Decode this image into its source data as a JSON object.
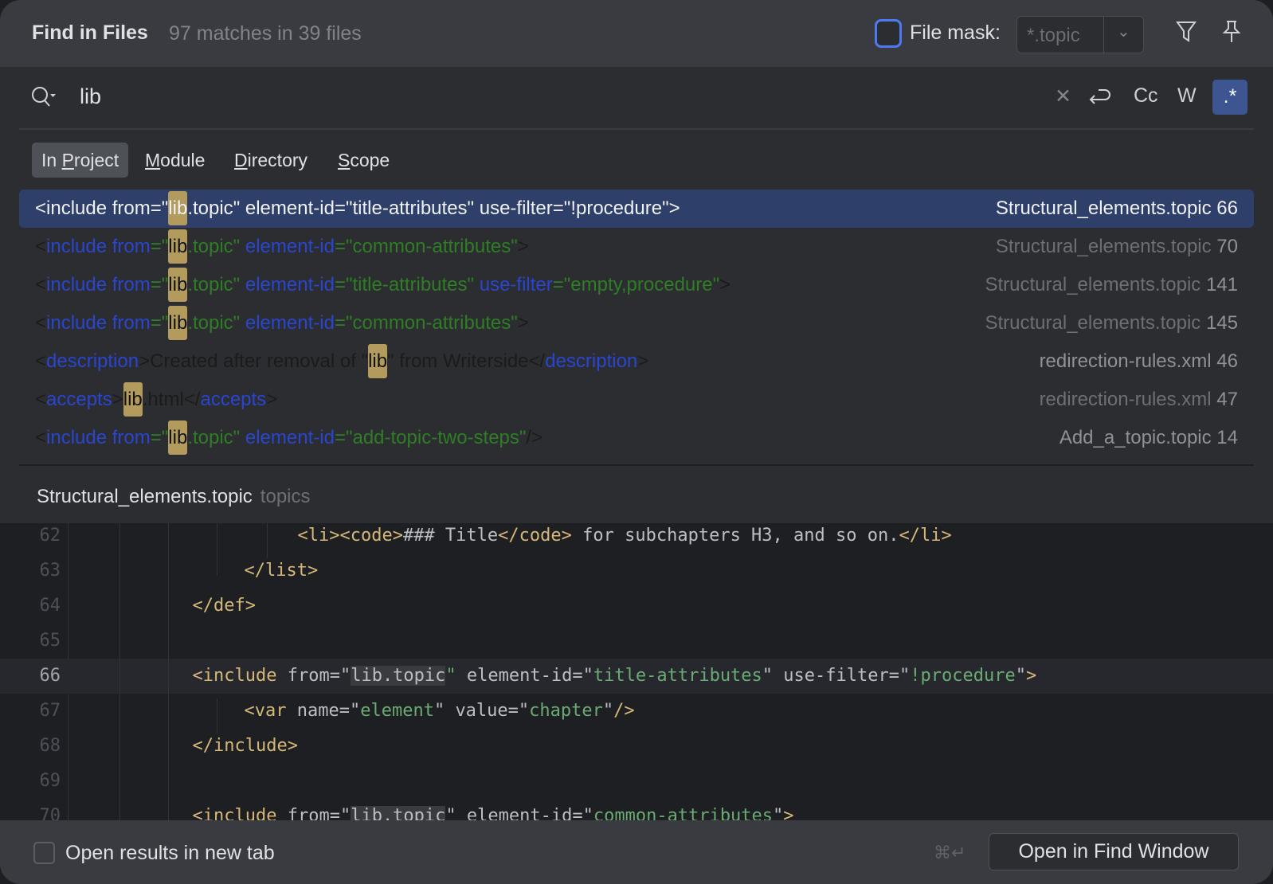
{
  "header": {
    "title": "Find in Files",
    "match_count": "97 matches in 39 files",
    "file_mask_label": "File mask:",
    "file_mask_value": "*.topic",
    "file_mask_checked": false
  },
  "search": {
    "query": "lib",
    "toggles": {
      "match_case": "Cc",
      "words": "W",
      "regex": ".*",
      "regex_active": true
    }
  },
  "scopes": [
    {
      "pre": "In ",
      "u": "P",
      "post": "roject",
      "active": true
    },
    {
      "pre": "",
      "u": "M",
      "post": "odule"
    },
    {
      "pre": "",
      "u": "D",
      "post": "irectory"
    },
    {
      "pre": "",
      "u": "S",
      "post": "cope"
    }
  ],
  "results": [
    {
      "selected": true,
      "segments": [
        [
          "c",
          "<"
        ],
        [
          "t",
          "include "
        ],
        [
          "t",
          "from"
        ],
        [
          "c",
          "=\""
        ],
        [
          "h",
          "lib"
        ],
        [
          "v",
          ".topic"
        ],
        [
          "c",
          "\" "
        ],
        [
          "t",
          "element-id"
        ],
        [
          "c",
          "=\""
        ],
        [
          "v",
          "title-attributes"
        ],
        [
          "c",
          "\" "
        ],
        [
          "t",
          "use-filter"
        ],
        [
          "c",
          "=\""
        ],
        [
          "v",
          "!procedure"
        ],
        [
          "c",
          "\">"
        ]
      ],
      "file": "Structural_elements.topic",
      "line": "66"
    },
    {
      "segments": [
        [
          "c",
          "<"
        ],
        [
          "t",
          "include "
        ],
        [
          "t",
          "from"
        ],
        [
          "v",
          "=\""
        ],
        [
          "h",
          "lib"
        ],
        [
          "v",
          ".topic\" "
        ],
        [
          "t",
          "element-id"
        ],
        [
          "v",
          "=\"common-attributes\""
        ],
        [
          "c",
          ">"
        ]
      ],
      "file": "Structural_elements.topic",
      "line": "70"
    },
    {
      "segments": [
        [
          "c",
          "<"
        ],
        [
          "t",
          "include "
        ],
        [
          "t",
          "from"
        ],
        [
          "v",
          "=\""
        ],
        [
          "h",
          "lib"
        ],
        [
          "v",
          ".topic\" "
        ],
        [
          "t",
          "element-id"
        ],
        [
          "v",
          "=\"title-attributes\" "
        ],
        [
          "t",
          "use-filter"
        ],
        [
          "v",
          "=\"empty,procedure\""
        ],
        [
          "c",
          ">"
        ]
      ],
      "file": "Structural_elements.topic",
      "line": "141"
    },
    {
      "segments": [
        [
          "c",
          "<"
        ],
        [
          "t",
          "include "
        ],
        [
          "t",
          "from"
        ],
        [
          "v",
          "=\""
        ],
        [
          "h",
          "lib"
        ],
        [
          "v",
          ".topic\" "
        ],
        [
          "t",
          "element-id"
        ],
        [
          "v",
          "=\"common-attributes\""
        ],
        [
          "c",
          ">"
        ]
      ],
      "file": "Structural_elements.topic",
      "line": "145"
    },
    {
      "light": true,
      "segments": [
        [
          "c",
          "<"
        ],
        [
          "t",
          "description"
        ],
        [
          "c",
          ">Created after removal of \""
        ],
        [
          "h",
          "lib"
        ],
        [
          "c",
          "\" from Writerside</"
        ],
        [
          "t",
          "description"
        ],
        [
          "c",
          ">"
        ]
      ],
      "file": "redirection-rules.xml",
      "line": "46"
    },
    {
      "segments": [
        [
          "c",
          "<"
        ],
        [
          "t",
          "accepts"
        ],
        [
          "c",
          ">"
        ],
        [
          "h",
          "lib"
        ],
        [
          "c",
          ".html</"
        ],
        [
          "t",
          "accepts"
        ],
        [
          "c",
          ">"
        ]
      ],
      "file": "redirection-rules.xml",
      "line": "47"
    },
    {
      "light": true,
      "segments": [
        [
          "c",
          "<"
        ],
        [
          "t",
          "include "
        ],
        [
          "t",
          "from"
        ],
        [
          "v",
          "=\""
        ],
        [
          "h",
          "lib"
        ],
        [
          "v",
          ".topic\" "
        ],
        [
          "t",
          "element-id"
        ],
        [
          "v",
          "=\"add-topic-two-steps\""
        ],
        [
          "c",
          "/>"
        ]
      ],
      "file": "Add_a_topic.topic",
      "line": "14"
    }
  ],
  "preview": {
    "file": "Structural_elements.topic",
    "folder": "topics",
    "lines": [
      {
        "n": "62",
        "indent": 9,
        "segs": [
          [
            "tg",
            "<li><code>"
          ],
          [
            "pl",
            "### Title"
          ],
          [
            "tg",
            "</code>"
          ],
          [
            "pl",
            " for subchapters H3, and so on."
          ],
          [
            "tg",
            "</li>"
          ]
        ]
      },
      {
        "n": "63",
        "indent": 7,
        "segs": [
          [
            "tg",
            "</list>"
          ]
        ]
      },
      {
        "n": "64",
        "indent": 5,
        "segs": [
          [
            "tg",
            "</def>"
          ]
        ]
      },
      {
        "n": "65",
        "indent": 0,
        "segs": []
      },
      {
        "n": "66",
        "indent": 5,
        "current": true,
        "segs": [
          [
            "tg",
            "<include "
          ],
          [
            "at",
            "from"
          ],
          [
            "pl",
            "=\""
          ],
          [
            "mk",
            "lib.topic"
          ],
          [
            "vl",
            "\" "
          ],
          [
            "at",
            "element-id"
          ],
          [
            "pl",
            "=\""
          ],
          [
            "vl",
            "title-attributes"
          ],
          [
            "pl",
            "\" "
          ],
          [
            "at",
            "use-filter"
          ],
          [
            "pl",
            "=\""
          ],
          [
            "vl",
            "!procedure"
          ],
          [
            "pl",
            "\""
          ],
          [
            "tg",
            ">"
          ]
        ]
      },
      {
        "n": "67",
        "indent": 7,
        "segs": [
          [
            "tg",
            "<var "
          ],
          [
            "at",
            "name"
          ],
          [
            "pl",
            "=\""
          ],
          [
            "vl",
            "element"
          ],
          [
            "pl",
            "\" "
          ],
          [
            "at",
            "value"
          ],
          [
            "pl",
            "=\""
          ],
          [
            "vl",
            "chapter"
          ],
          [
            "pl",
            "\""
          ],
          [
            "tg",
            "/>"
          ]
        ]
      },
      {
        "n": "68",
        "indent": 5,
        "segs": [
          [
            "tg",
            "</include>"
          ]
        ]
      },
      {
        "n": "69",
        "indent": 0,
        "segs": []
      },
      {
        "n": "70",
        "indent": 5,
        "segs": [
          [
            "tg",
            "<include "
          ],
          [
            "at",
            "from"
          ],
          [
            "pl",
            "=\""
          ],
          [
            "mk",
            "lib.topic"
          ],
          [
            "pl",
            "\" "
          ],
          [
            "at",
            "element-id"
          ],
          [
            "pl",
            "=\""
          ],
          [
            "vl",
            "common-attributes"
          ],
          [
            "pl",
            "\""
          ],
          [
            "tg",
            ">"
          ]
        ]
      }
    ]
  },
  "footer": {
    "open_new_tab_label": "Open results in new tab",
    "open_new_tab_checked": false,
    "shortcut": "⌘↵",
    "open_button": "Open in Find Window"
  }
}
